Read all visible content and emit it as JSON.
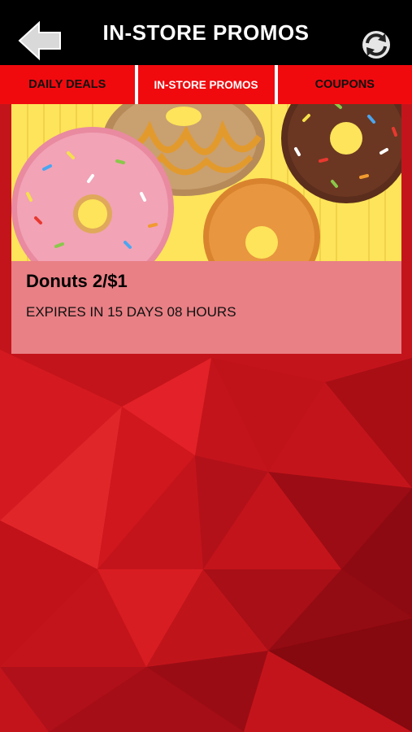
{
  "header": {
    "title": "IN-STORE PROMOS",
    "back_icon": "back-arrow-icon",
    "refresh_icon": "refresh-icon"
  },
  "tabs": [
    {
      "label": "DAILY DEALS",
      "active": false
    },
    {
      "label": "IN-STORE PROMOS",
      "active": true
    },
    {
      "label": "COUPONS",
      "active": false
    }
  ],
  "promos": [
    {
      "title": "Donuts 2/$1",
      "expiry": "EXPIRES IN 15 DAYS 08 HOURS",
      "image": "donuts-image"
    }
  ],
  "colors": {
    "header_bg": "#000000",
    "tab_bg": "#f00a0e",
    "background": "#b5121b",
    "image_bg": "#fde45a"
  }
}
